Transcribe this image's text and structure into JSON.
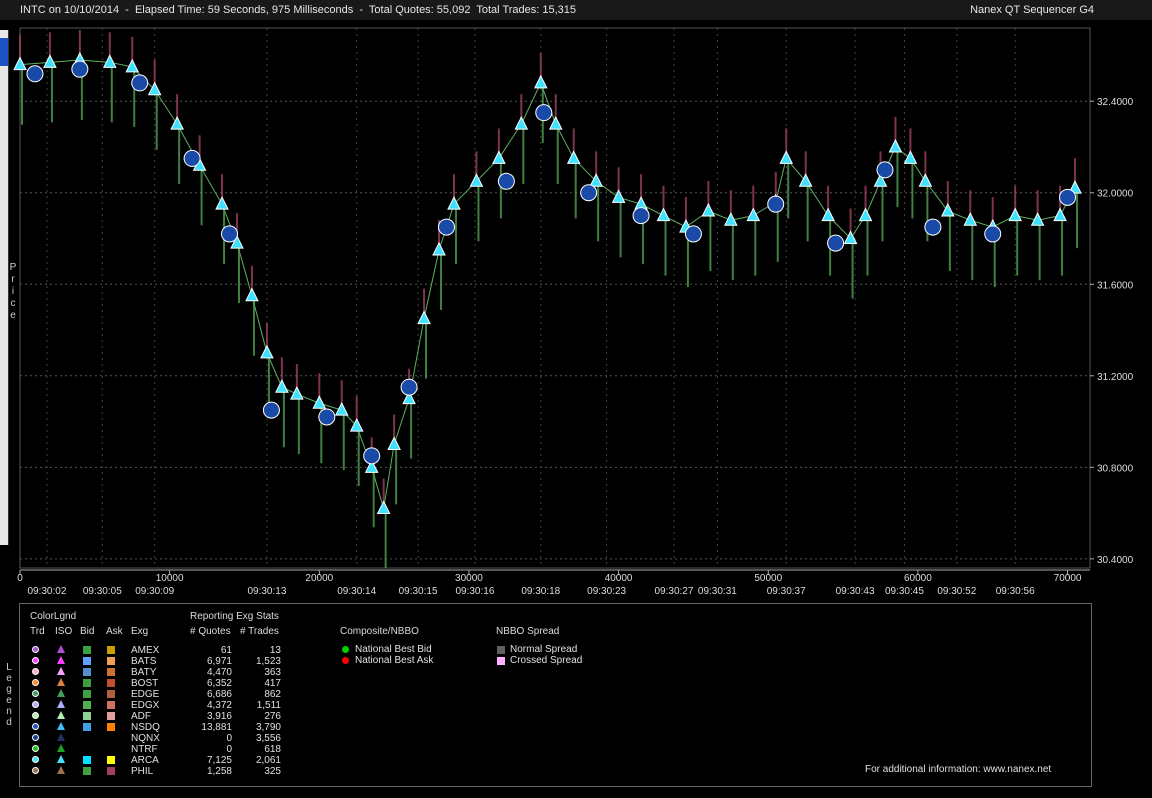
{
  "header": {
    "title": "INTC on 10/10/2014  -  Elapsed Time: 59 Seconds, 975 Milliseconds  -  Total Quotes: 55,092  Total Trades: 15,315",
    "app": "Nanex QT Sequencer G4"
  },
  "axis_label_vertical": "Price",
  "legend_vertical": "Legend",
  "chart_data": {
    "type": "scatter",
    "title": "",
    "xlabel": "",
    "ylabel": "Price",
    "xlim": [
      0,
      71500
    ],
    "ylim": [
      30.36,
      32.72
    ],
    "x_ticks": [
      0,
      10000,
      20000,
      30000,
      40000,
      50000,
      60000,
      70000
    ],
    "x_tick_labels": [
      "0",
      "10000",
      "20000",
      "30000",
      "40000",
      "50000",
      "60000",
      "70000"
    ],
    "y_ticks": [
      30.4,
      30.8,
      31.2,
      31.6,
      32.0,
      32.4
    ],
    "y_tick_labels": [
      "30.4000",
      "30.8000",
      "31.2000",
      "31.6000",
      "32.0000",
      "32.4000"
    ],
    "time_labels": [
      {
        "x": 1800,
        "label": "09:30:02"
      },
      {
        "x": 5500,
        "label": "09:30:05"
      },
      {
        "x": 9000,
        "label": "09:30:09"
      },
      {
        "x": 16500,
        "label": "09:30:13"
      },
      {
        "x": 22500,
        "label": "09:30:14"
      },
      {
        "x": 26600,
        "label": "09:30:15"
      },
      {
        "x": 30400,
        "label": "09:30:16"
      },
      {
        "x": 34800,
        "label": "09:30:18"
      },
      {
        "x": 39200,
        "label": "09:30:23"
      },
      {
        "x": 43700,
        "label": "09:30:27"
      },
      {
        "x": 46600,
        "label": "09:30:31"
      },
      {
        "x": 51200,
        "label": "09:30:37"
      },
      {
        "x": 55800,
        "label": "09:30:43"
      },
      {
        "x": 59100,
        "label": "09:30:45"
      },
      {
        "x": 62600,
        "label": "09:30:52"
      },
      {
        "x": 66500,
        "label": "09:30:56"
      }
    ],
    "series": [
      {
        "name": "Trades",
        "x": [
          0,
          2000,
          4000,
          6000,
          7500,
          9000,
          10500,
          12000,
          13500,
          14500,
          15500,
          16500,
          17500,
          18500,
          20000,
          21500,
          22500,
          23500,
          24300,
          25000,
          26000,
          27000,
          28000,
          29000,
          30500,
          32000,
          33500,
          34800,
          35800,
          37000,
          38500,
          40000,
          41500,
          43000,
          44500,
          46000,
          47500,
          49000,
          50500,
          51200,
          52500,
          54000,
          55500,
          56500,
          57500,
          58500,
          59500,
          60500,
          62000,
          63500,
          65000,
          66500,
          68000,
          69500,
          70500
        ],
        "y": [
          32.56,
          32.57,
          32.58,
          32.57,
          32.55,
          32.45,
          32.3,
          32.12,
          31.95,
          31.78,
          31.55,
          31.3,
          31.15,
          31.12,
          31.08,
          31.05,
          30.98,
          30.8,
          30.62,
          30.9,
          31.1,
          31.45,
          31.75,
          31.95,
          32.05,
          32.15,
          32.3,
          32.48,
          32.3,
          32.15,
          32.05,
          31.98,
          31.95,
          31.9,
          31.85,
          31.92,
          31.88,
          31.9,
          31.96,
          32.15,
          32.05,
          31.9,
          31.8,
          31.9,
          32.05,
          32.2,
          32.15,
          32.05,
          31.92,
          31.88,
          31.85,
          31.9,
          31.88,
          31.9,
          32.02
        ]
      },
      {
        "name": "National Best Bid",
        "x": [
          1000,
          4000,
          8000,
          11500,
          14000,
          16800,
          20500,
          23500,
          26000,
          28500,
          32500,
          35000,
          38000,
          41500,
          45000,
          50500,
          54500,
          57800,
          61000,
          65000,
          70000
        ],
        "y": [
          32.52,
          32.54,
          32.48,
          32.15,
          31.82,
          31.05,
          31.02,
          30.85,
          31.15,
          31.85,
          32.05,
          32.35,
          32.0,
          31.9,
          31.82,
          31.95,
          31.78,
          32.1,
          31.85,
          31.82,
          31.98
        ]
      }
    ]
  },
  "legend": {
    "color_legend": "ColorLgnd",
    "cols": {
      "trd": "Trd",
      "iso": "ISO",
      "bid": "Bid",
      "ask": "Ask",
      "exg": "Exg"
    },
    "stats_title": "Reporting Exg Stats",
    "stats_cols": {
      "quotes": "# Quotes",
      "trades": "# Trades"
    },
    "exchanges": [
      {
        "name": "AMEX",
        "quotes": "61",
        "trades": "13",
        "dot": "#b050d0",
        "tri": "#b050d0",
        "bid": "#3ca03c",
        "ask": "#c8a000"
      },
      {
        "name": "BATS",
        "quotes": "6,971",
        "trades": "1,523",
        "dot": "#ff40ff",
        "tri": "#ff40ff",
        "bid": "#60a0ff",
        "ask": "#f0a050"
      },
      {
        "name": "BATY",
        "quotes": "4,470",
        "trades": "363",
        "dot": "#ffb0c0",
        "tri": "#ffa0ff",
        "bid": "#5090d0",
        "ask": "#d07030"
      },
      {
        "name": "BOST",
        "quotes": "6,352",
        "trades": "417",
        "dot": "#ff8030",
        "tri": "#e08040",
        "bid": "#3ca03c",
        "ask": "#c05030"
      },
      {
        "name": "EDGE",
        "quotes": "6,686",
        "trades": "862",
        "dot": "#40a060",
        "tri": "#40a060",
        "bid": "#40a040",
        "ask": "#b06040"
      },
      {
        "name": "EDGX",
        "quotes": "4,372",
        "trades": "1,511",
        "dot": "#b0b0ff",
        "tri": "#b0b0ff",
        "bid": "#50b050",
        "ask": "#d07060"
      },
      {
        "name": "ADF",
        "quotes": "3,916",
        "trades": "276",
        "dot": "#b0f0b0",
        "tri": "#b0f0b0",
        "bid": "#90d090",
        "ask": "#e0a0a0"
      },
      {
        "name": "NSDQ",
        "quotes": "13,881",
        "trades": "3,790",
        "dot": "#2050c0",
        "tri": "#40c0ff",
        "bid": "#40a0e0",
        "ask": "#ff8000"
      },
      {
        "name": "NQNX",
        "quotes": "0",
        "trades": "3,556",
        "dot": "#1a3f8f",
        "tri": "#203060",
        "bid": "",
        "ask": ""
      },
      {
        "name": "NTRF",
        "quotes": "0",
        "trades": "618",
        "dot": "#20c020",
        "tri": "#20a020",
        "bid": "",
        "ask": ""
      },
      {
        "name": "ARCA",
        "quotes": "7,125",
        "trades": "2,061",
        "dot": "#40e0ff",
        "tri": "#40e0ff",
        "bid": "#00e0ff",
        "ask": "#ffff00"
      },
      {
        "name": "PHIL",
        "quotes": "1,258",
        "trades": "325",
        "dot": "#a07050",
        "tri": "#a07050",
        "bid": "#40a040",
        "ask": "#a04060"
      }
    ],
    "composite_title": "Composite/NBBO",
    "nbb_label": "National Best Bid",
    "nbo_label": "National Best Ask",
    "spread_title": "NBBO Spread",
    "normal_spread": "Normal Spread",
    "crossed_spread": "Crossed Spread",
    "colors": {
      "nbb": "#00d000",
      "nbo": "#ff0000",
      "normal": "#606060",
      "crossed": "#ffb0ff"
    },
    "footer": "For additional information: www.nanex.net"
  }
}
